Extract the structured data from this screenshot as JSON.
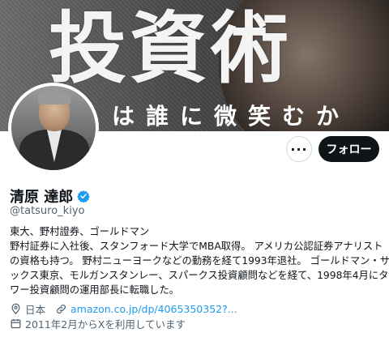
{
  "banner": {
    "title": "投資術",
    "subtitle": "は誰に微笑むか"
  },
  "profile": {
    "name": "清原 達郎",
    "handle": "@tatsuro_kiyo",
    "follow_label": "フォロー",
    "more_label": "···",
    "bio_lines": [
      "東大、野村證券、ゴールドマン",
      "野村証券に入社後、スタンフォード大学でMBA取得。 アメリカ公認証券アナリスト",
      "の資格も持つ。 野村ニューヨークなどの勤務を経て1993年退社。 ゴールドマン・サ",
      "ックス東京、モルガンスタンレー、スパークス投資顧問などを経て、1998年4月にタ",
      "ワー投資顧問の運用部長に転職した。"
    ],
    "location": "日本",
    "website": "amazon.co.jp/dp/4065350352?...",
    "joined": "2011年2月からXを利用しています"
  },
  "colors": {
    "verified": "#1d9bf0",
    "link": "#1d9bf0",
    "follow_bg": "#0f1419"
  }
}
